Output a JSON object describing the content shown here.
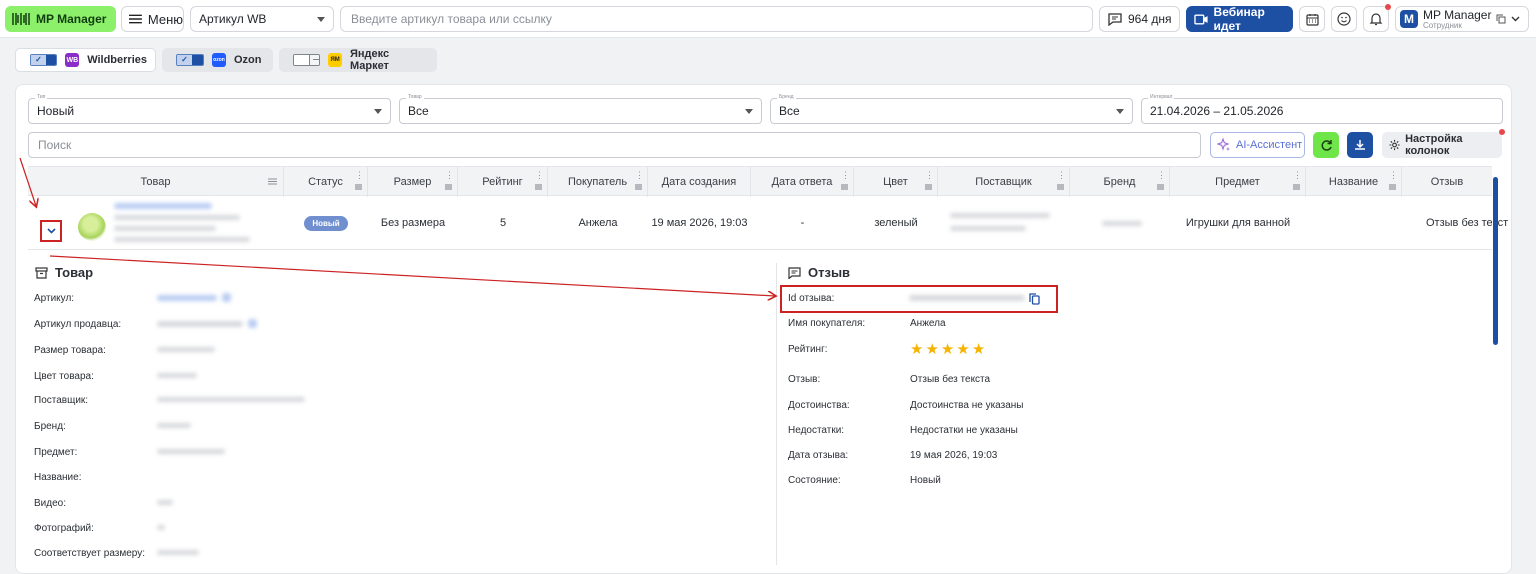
{
  "topbar": {
    "brand": "MP Manager",
    "menu_label": "Меню",
    "article_select": "Артикул WB",
    "search_placeholder": "Введите артикул товара или ссылку",
    "days": "964 дня",
    "webinar": "Вебинар идет",
    "account_name": "MP Manager",
    "account_role": "Сотрудник",
    "account_logo": "M"
  },
  "marketplaces": [
    {
      "name": "Wildberries",
      "logo": "WB",
      "enabled": true,
      "color": "#8b2dc9"
    },
    {
      "name": "Ozon",
      "logo": "ozon",
      "enabled": true,
      "color": "#1f5bff"
    },
    {
      "name": "Яндекс Маркет",
      "logo": "ЯМ",
      "enabled": false,
      "color": "#ffcc00"
    }
  ],
  "filters": {
    "type": {
      "label": "Тип",
      "value": "Новый"
    },
    "product": {
      "label": "Товар",
      "value": "Все"
    },
    "brand": {
      "label": "Бренд",
      "value": "Все"
    },
    "interval": {
      "label": "Интервал",
      "value": "21.04.2026 – 21.05.2026"
    }
  },
  "toolbar": {
    "search_placeholder": "Поиск",
    "ai_label": "AI-Ассистент",
    "columns_label": "Настройка колонок"
  },
  "table": {
    "headers": [
      "Товар",
      "Статус",
      "Размер",
      "Рейтинг",
      "Покупатель",
      "Дата создания",
      "Дата ответа",
      "Цвет",
      "Поставщик",
      "Бренд",
      "Предмет",
      "Название",
      "Отзыв"
    ],
    "row": {
      "status": "Новый",
      "size": "Без размера",
      "rating": "5",
      "buyer": "Анжела",
      "created": "19 мая 2026, 19:03",
      "answered": "-",
      "color": "зеленый",
      "subject": "Игрушки для ванной",
      "review": "Отзыв без текст"
    }
  },
  "product_details": {
    "title": "Товар",
    "fields": [
      "Артикул:",
      "Артикул продавца:",
      "Размер товара:",
      "Цвет товара:",
      "Поставщик:",
      "Бренд:",
      "Предмет:",
      "Название:",
      "Видео:",
      "Фотографий:",
      "Соответствует размеру:"
    ]
  },
  "review_details": {
    "title": "Отзыв",
    "id_label": "Id отзыва:",
    "buyer_label": "Имя покупателя:",
    "buyer": "Анжела",
    "rating_label": "Рейтинг:",
    "rating": 5,
    "text_label": "Отзыв:",
    "text": "Отзыв без текста",
    "pros_label": "Достоинства:",
    "pros": "Достоинства не указаны",
    "cons_label": "Недостатки:",
    "cons": "Недостатки не указаны",
    "date_label": "Дата отзыва:",
    "date": "19 мая 2026, 19:03",
    "state_label": "Состояние:",
    "state": "Новый"
  },
  "colors": {
    "accent": "#1d4fa3",
    "brand_green": "#8cf06a",
    "annotation_red": "#cc2222",
    "star": "#f5b400"
  }
}
